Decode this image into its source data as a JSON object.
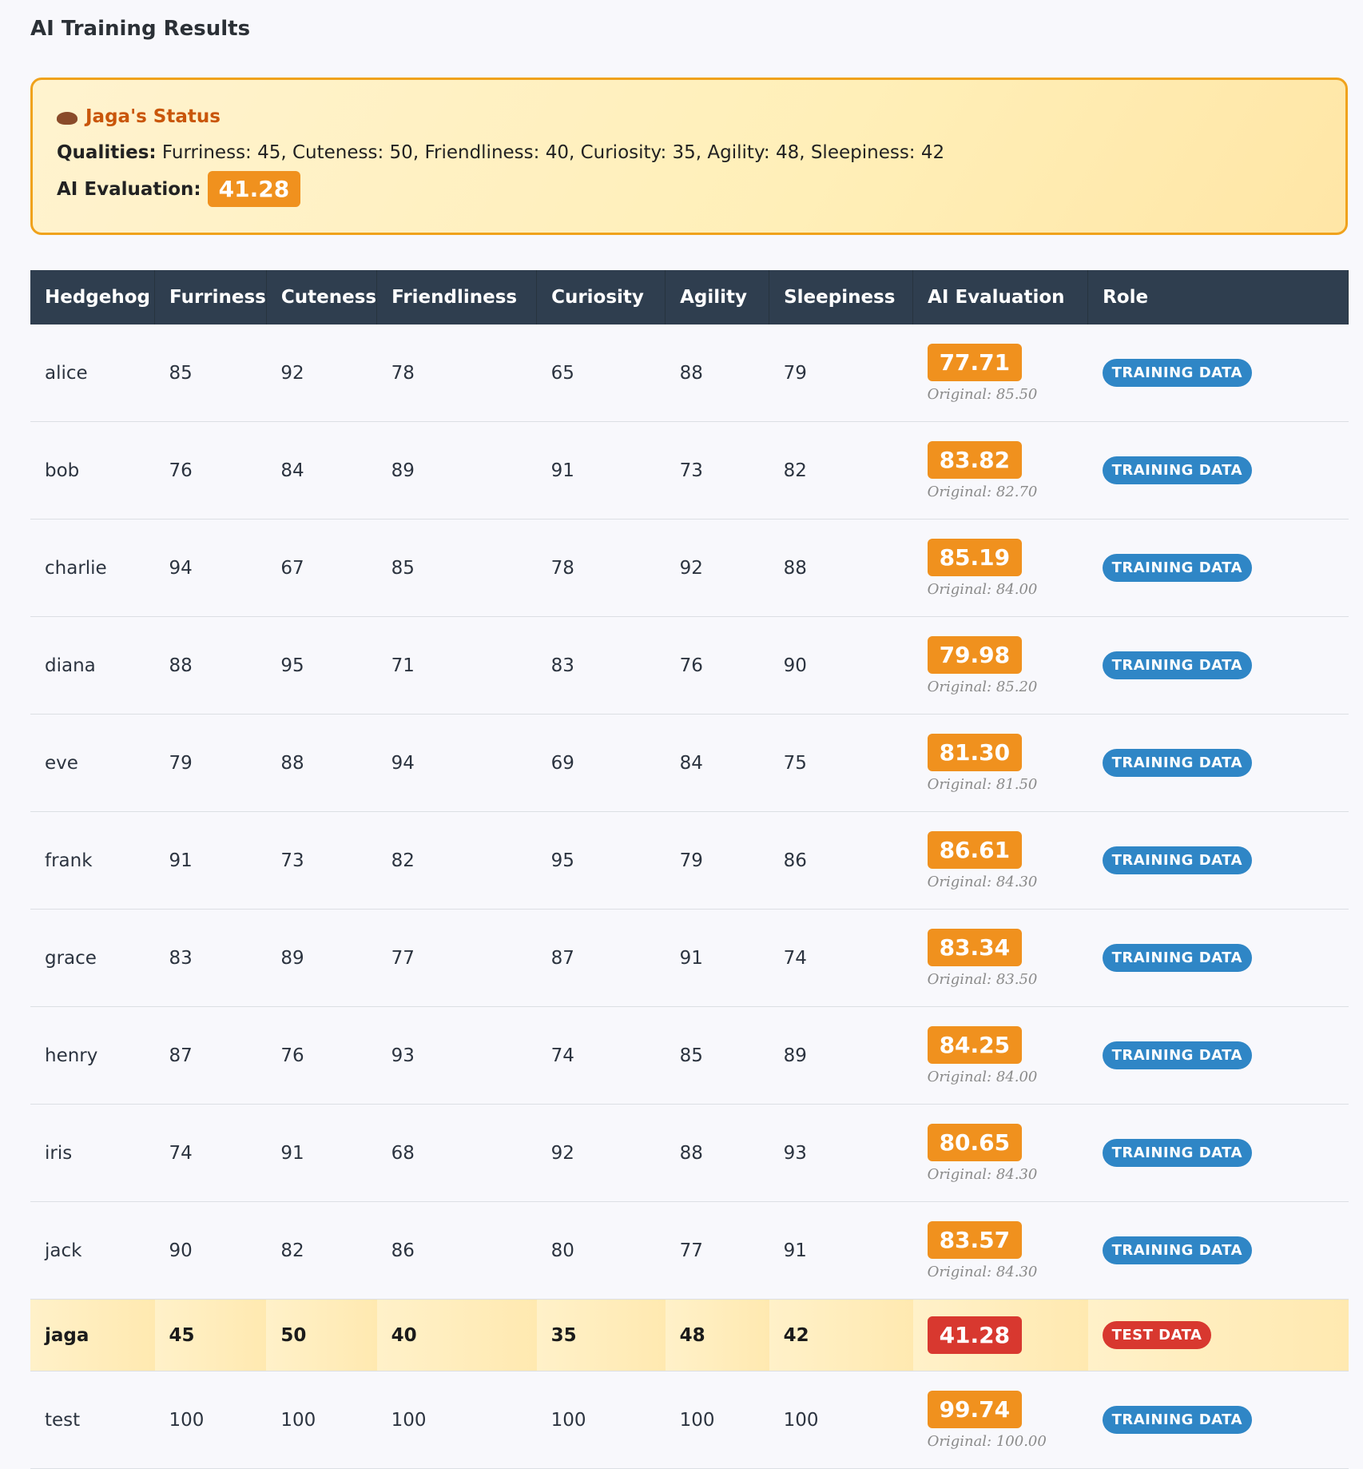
{
  "page_title": "AI Training Results",
  "status": {
    "title": "Jaga's Status",
    "qualities_label": "Qualities:",
    "qualities_value": "Furriness: 45, Cuteness: 50, Friendliness: 40, Curiosity: 35, Agility: 48, Sleepiness: 42",
    "eval_label": "AI Evaluation:",
    "eval_value": "41.28",
    "colors": {
      "border": "#f0a21c",
      "title": "#c9560a",
      "pill": "#f0911e"
    },
    "icon": "hedgehog-icon"
  },
  "table": {
    "headers": [
      "Hedgehog",
      "Furriness",
      "Cuteness",
      "Friendliness",
      "Curiosity",
      "Agility",
      "Sleepiness",
      "AI Evaluation",
      "Role"
    ],
    "rows": [
      {
        "name": "alice",
        "furriness": "85",
        "cuteness": "92",
        "friendliness": "78",
        "curiosity": "65",
        "agility": "88",
        "sleepiness": "79",
        "ai_eval": "77.71",
        "original": "Original: 85.50",
        "role": "TRAINING DATA"
      },
      {
        "name": "bob",
        "furriness": "76",
        "cuteness": "84",
        "friendliness": "89",
        "curiosity": "91",
        "agility": "73",
        "sleepiness": "82",
        "ai_eval": "83.82",
        "original": "Original: 82.70",
        "role": "TRAINING DATA"
      },
      {
        "name": "charlie",
        "furriness": "94",
        "cuteness": "67",
        "friendliness": "85",
        "curiosity": "78",
        "agility": "92",
        "sleepiness": "88",
        "ai_eval": "85.19",
        "original": "Original: 84.00",
        "role": "TRAINING DATA"
      },
      {
        "name": "diana",
        "furriness": "88",
        "cuteness": "95",
        "friendliness": "71",
        "curiosity": "83",
        "agility": "76",
        "sleepiness": "90",
        "ai_eval": "79.98",
        "original": "Original: 85.20",
        "role": "TRAINING DATA"
      },
      {
        "name": "eve",
        "furriness": "79",
        "cuteness": "88",
        "friendliness": "94",
        "curiosity": "69",
        "agility": "84",
        "sleepiness": "75",
        "ai_eval": "81.30",
        "original": "Original: 81.50",
        "role": "TRAINING DATA"
      },
      {
        "name": "frank",
        "furriness": "91",
        "cuteness": "73",
        "friendliness": "82",
        "curiosity": "95",
        "agility": "79",
        "sleepiness": "86",
        "ai_eval": "86.61",
        "original": "Original: 84.30",
        "role": "TRAINING DATA"
      },
      {
        "name": "grace",
        "furriness": "83",
        "cuteness": "89",
        "friendliness": "77",
        "curiosity": "87",
        "agility": "91",
        "sleepiness": "74",
        "ai_eval": "83.34",
        "original": "Original: 83.50",
        "role": "TRAINING DATA"
      },
      {
        "name": "henry",
        "furriness": "87",
        "cuteness": "76",
        "friendliness": "93",
        "curiosity": "74",
        "agility": "85",
        "sleepiness": "89",
        "ai_eval": "84.25",
        "original": "Original: 84.00",
        "role": "TRAINING DATA"
      },
      {
        "name": "iris",
        "furriness": "74",
        "cuteness": "91",
        "friendliness": "68",
        "curiosity": "92",
        "agility": "88",
        "sleepiness": "93",
        "ai_eval": "80.65",
        "original": "Original: 84.30",
        "role": "TRAINING DATA"
      },
      {
        "name": "jack",
        "furriness": "90",
        "cuteness": "82",
        "friendliness": "86",
        "curiosity": "80",
        "agility": "77",
        "sleepiness": "91",
        "ai_eval": "83.57",
        "original": "Original: 84.30",
        "role": "TRAINING DATA"
      },
      {
        "name": "jaga",
        "furriness": "45",
        "cuteness": "50",
        "friendliness": "40",
        "curiosity": "35",
        "agility": "48",
        "sleepiness": "42",
        "ai_eval": "41.28",
        "original": "",
        "role": "TEST DATA",
        "highlight": true
      },
      {
        "name": "test",
        "furriness": "100",
        "cuteness": "100",
        "friendliness": "100",
        "curiosity": "100",
        "agility": "100",
        "sleepiness": "100",
        "ai_eval": "99.74",
        "original": "Original: 100.00",
        "role": "TRAINING DATA"
      }
    ]
  },
  "colors": {
    "header_bg": "#2f3e4f",
    "score_orange": "#f0911e",
    "score_red": "#d8382f",
    "badge_blue": "#2f86c6",
    "badge_red": "#d8382f",
    "highlight_bg": "#fff1c9"
  }
}
